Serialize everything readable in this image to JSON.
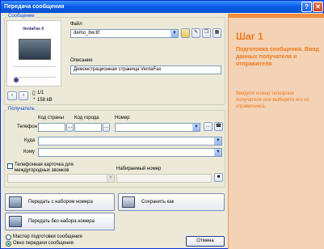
{
  "window": {
    "title": "Передача сообщения",
    "help_glyph": "?",
    "close_glyph": "✕"
  },
  "message": {
    "group_title": "Сообщение",
    "thumb_logo": "VentaFax 6",
    "file_label": "Файл",
    "file_value": "demo_bw.tif",
    "desc_label": "Описание",
    "desc_value": "Демонстрационная страница VentaFax",
    "page_count": "1/1",
    "file_size": "158 kB"
  },
  "recipient": {
    "group_title": "Получатель",
    "country_code_label": "Код страны",
    "city_code_label": "Код города",
    "number_label": "Номер",
    "phone_label": "Телефон",
    "to_label": "Куда",
    "whom_label": "Кому",
    "card_checkbox_label": "Телефонная карточка для междугородных звонков",
    "dialed_number_label": "Набираемый номер",
    "browse_glyph": "..."
  },
  "actions": {
    "send_dial": "Передать с набором номера",
    "save_as": "Сохранить как",
    "send_no_dial": "Передать без набора номера"
  },
  "footer": {
    "wizard_label": "Мастер подготовки сообщения",
    "window_label": "Окно передачи сообщения",
    "mode_selected": "window",
    "cancel": "Отмена"
  },
  "help_panel": {
    "step": "Шаг 1",
    "subtitle": "Подготовка сообщения. Ввод данных получателя и отправителя",
    "text": "Введите номер телефона получателя или выберите его из справочника."
  },
  "colors": {
    "accent": "#ef7a1c",
    "panel_bg": "#f3d2b5",
    "title_bar": "#0a5ee8",
    "group_title": "#0046d5"
  }
}
